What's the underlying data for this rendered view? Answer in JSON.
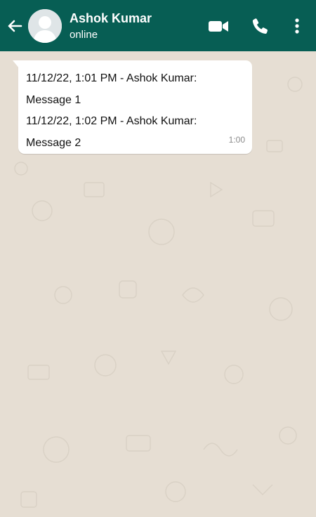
{
  "header": {
    "contact_name": "Ashok  Kumar",
    "status": "online",
    "icons": {
      "back": "arrow-back-icon",
      "avatar": "default-avatar-icon",
      "video": "video-call-icon",
      "call": "phone-call-icon",
      "menu": "more-vertical-icon"
    }
  },
  "messages": [
    {
      "lines": [
        "11/12/22, 1:01 PM - Ashok Kumar:",
        "Message 1",
        "11/12/22, 1:02 PM - Ashok Kumar:",
        "Message 2"
      ],
      "time": "1:00"
    }
  ],
  "colors": {
    "header": "#075e54",
    "wallpaper": "#e6ded3",
    "bubble": "#ffffff",
    "timestamp": "#8a8a8a"
  }
}
